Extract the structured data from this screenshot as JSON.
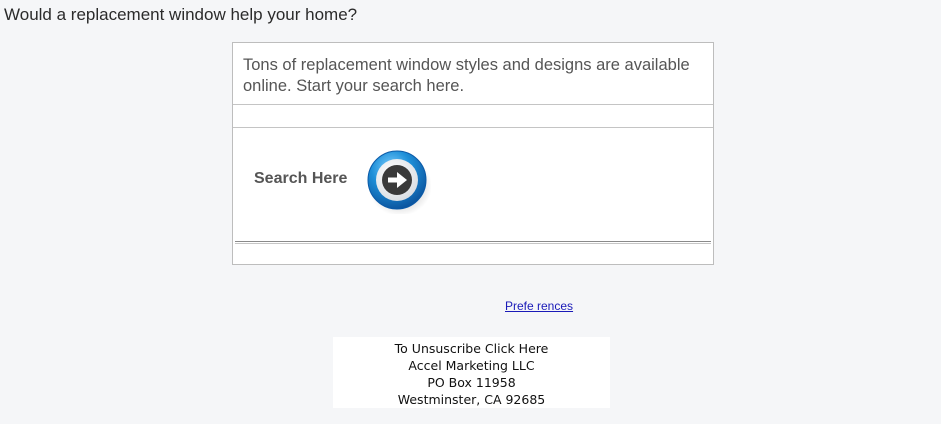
{
  "headline": "Would a replacement window help your home?",
  "card": {
    "intro_text": "Tons of replacement window styles and designs are available online. Start your search here.",
    "search_label": "Search Here",
    "search_icon": "arrow-right-circle-icon"
  },
  "links": {
    "preferences": "Prefe rences"
  },
  "footer": {
    "unsubscribe": "To Unsuscribe Click Here",
    "company": "Accel Marketing LLC",
    "po_box": "PO Box 11958",
    "city": "Westminster, CA 92685"
  },
  "colors": {
    "page_bg": "#f5f6f8",
    "link": "#1a1ab8",
    "button_ring": "#1e8fd8",
    "button_center": "#333333"
  }
}
